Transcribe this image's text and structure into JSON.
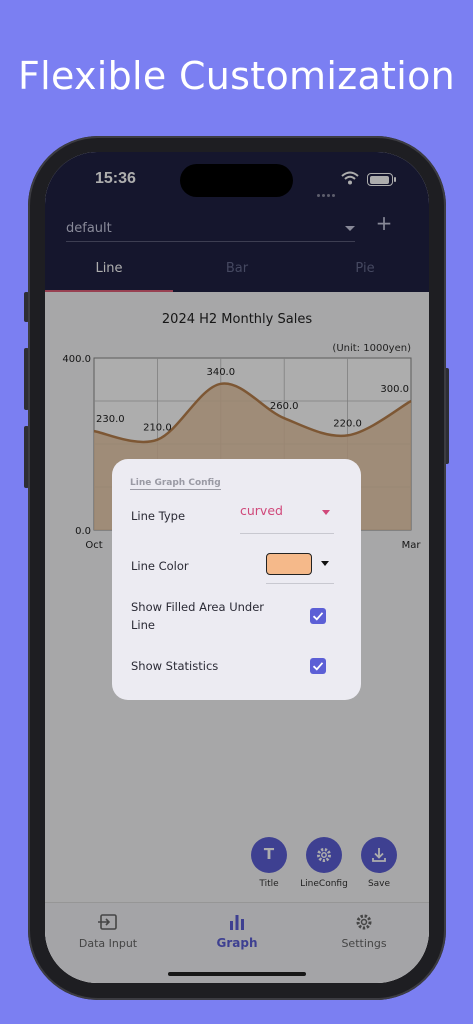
{
  "headline": "Flexible Customization",
  "status_bar": {
    "time": "15:36"
  },
  "header": {
    "profile_select": "default",
    "add_label": "+",
    "tabs": [
      {
        "label": "Line",
        "active": true
      },
      {
        "label": "Bar",
        "active": false
      },
      {
        "label": "Pie",
        "active": false
      }
    ]
  },
  "chart_data": {
    "type": "area",
    "title": "2024 H2 Monthly Sales",
    "unit_note": "(Unit: 1000yen)",
    "x": [
      "Oct",
      "",
      "",
      "",
      "",
      "Mar"
    ],
    "y_ticks": [
      "400.0",
      "0.0"
    ],
    "values": [
      230,
      210,
      340,
      260,
      220,
      300
    ],
    "data_labels": [
      "230.0",
      "210.0",
      "340.0",
      "260.0",
      "220.0",
      "300.0"
    ],
    "ylim": [
      0,
      400
    ],
    "line_style": "curved",
    "filled": true,
    "grid": true
  },
  "fabs": [
    {
      "icon": "title-icon",
      "label": "Title"
    },
    {
      "icon": "gear-icon",
      "label": "LineConfig"
    },
    {
      "icon": "download-icon",
      "label": "Save"
    }
  ],
  "bottom_nav": [
    {
      "icon": "data-input-icon",
      "label": "Data Input",
      "active": false
    },
    {
      "icon": "graph-icon",
      "label": "Graph",
      "active": true
    },
    {
      "icon": "gear-icon",
      "label": "Settings",
      "active": false
    }
  ],
  "dialog": {
    "title": "Line Graph Config",
    "line_type_label": "Line Type",
    "line_type_value": "curved",
    "line_color_label": "Line Color",
    "line_color_value": "#f5b98a",
    "show_filled_label": "Show Filled Area Under Line",
    "show_filled_checked": true,
    "show_stats_label": "Show Statistics",
    "show_stats_checked": true
  },
  "colors": {
    "accent": "#5c5fd6",
    "header_bg": "#1f2143",
    "tab_indicator": "#e0607a",
    "line_stroke": "#b8804d",
    "area_fill": "#e8c7a4",
    "page_bg": "#7b7ff2"
  }
}
